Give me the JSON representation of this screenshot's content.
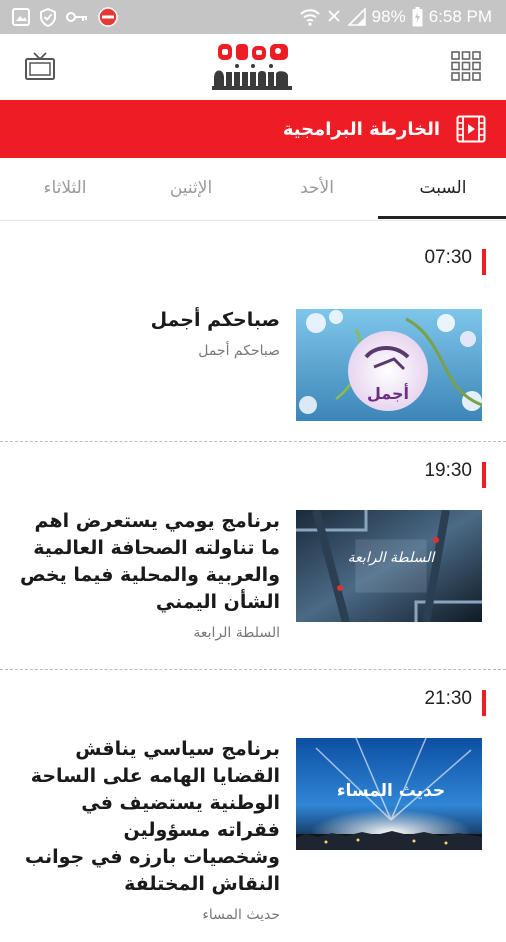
{
  "status_bar": {
    "battery": "98%",
    "time": "6:58 PM",
    "icons": [
      "image-icon",
      "shield-icon",
      "key-icon",
      "no-entry-icon",
      "wifi-icon",
      "no-signal-icon",
      "signal-icon",
      "battery-charging-icon"
    ]
  },
  "header": {
    "logo_alt": "يمن شباب",
    "left_icon": "tv-icon",
    "right_icon": "grid-menu-icon"
  },
  "banner": {
    "title": "الخارطة البرامجية",
    "icon": "film-play-icon",
    "color": "#ee1c25"
  },
  "tabs": [
    {
      "label": "السبت",
      "active": true
    },
    {
      "label": "الأحد",
      "active": false
    },
    {
      "label": "الإثنين",
      "active": false
    },
    {
      "label": "الثلاثاء",
      "active": false
    }
  ],
  "schedule": [
    {
      "time": "07:30",
      "title": "صباحكم أجمل",
      "subtitle": "صباحكم أجمل",
      "thumb_text": "أجمل"
    },
    {
      "time": "19:30",
      "title": "برنامج يومي يستعرض اهم ما تناولته الصحافة العالمية والعربية والمحلية فيما يخص الشأن اليمني",
      "subtitle": "السلطة الرابعة",
      "thumb_text": "السلطة الرابعة"
    },
    {
      "time": "21:30",
      "title": "برنامج سياسي يناقش القضايا الهامه على الساحة الوطنية يستضيف في فقراته مسؤولين وشخصيات بارزه في جوانب النقاش المختلفة",
      "subtitle": "حديث المساء",
      "thumb_text": "حديث المساء"
    }
  ]
}
